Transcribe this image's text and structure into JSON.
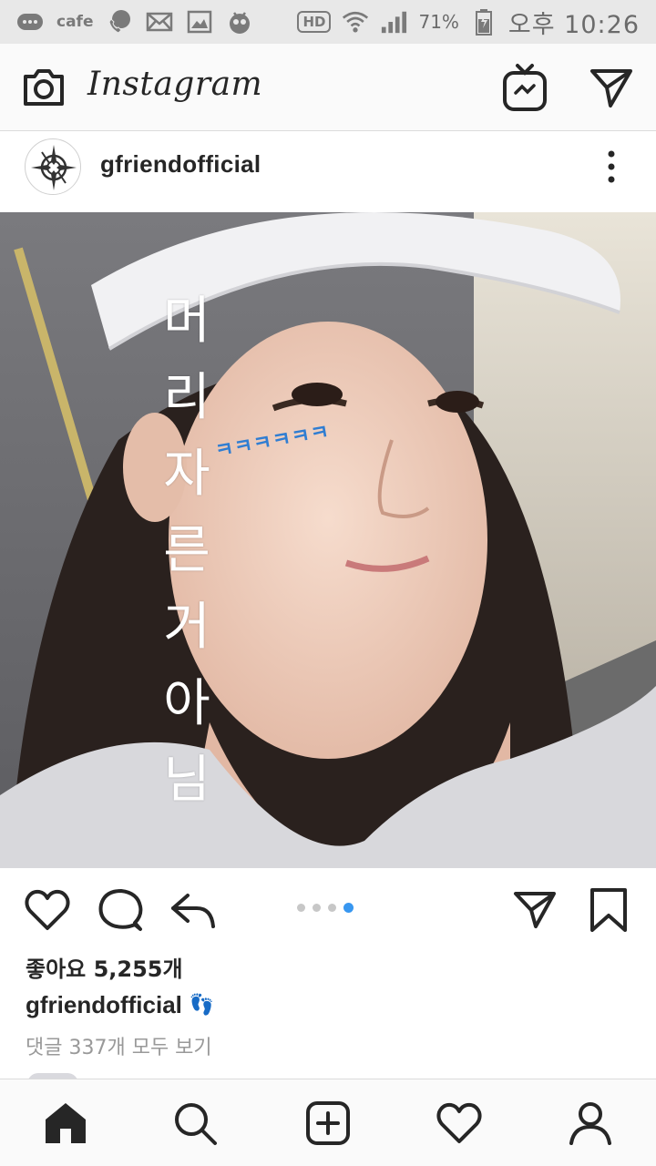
{
  "status_bar": {
    "carrier_app": "cafe",
    "hd": "HD",
    "battery": "71%",
    "time": "오후 10:26",
    "icons": [
      "chat-bubble-icon",
      "phone-bubble-icon",
      "mail-icon",
      "gallery-icon",
      "app-icon",
      "wifi-icon",
      "signal-icon",
      "battery-icon"
    ]
  },
  "app_bar": {
    "title": "Instagram",
    "left_icon": "camera-icon",
    "right_icons": [
      "igtv-icon",
      "direct-icon"
    ]
  },
  "post": {
    "username": "gfriendofficial",
    "more_icon": "more-vertical-icon",
    "overlay_text": [
      "머",
      "리",
      "자",
      "른",
      "거",
      "아",
      "님"
    ],
    "overlay_laugh": "ㅋㅋㅋㅋㅋㅋ",
    "carousel": {
      "count": 4,
      "active_index": 3
    },
    "likes": "좋아요 5,255개",
    "caption_user": "gfriendofficial",
    "caption_emoji": "👣",
    "comments_link": "댓글 337개 모두 보기"
  },
  "actions": [
    "heart-icon",
    "comment-icon",
    "share-icon",
    "direct-icon",
    "bookmark-icon"
  ],
  "bottom_nav": [
    "home-icon",
    "search-icon",
    "add-post-icon",
    "activity-icon",
    "profile-icon"
  ],
  "colors": {
    "accent_blue": "#3897f0",
    "laugh_blue": "#2f7dd2",
    "text": "#262626",
    "muted": "#999999",
    "divider": "#dbdbdb",
    "status_bar": "#e8e8e8"
  }
}
